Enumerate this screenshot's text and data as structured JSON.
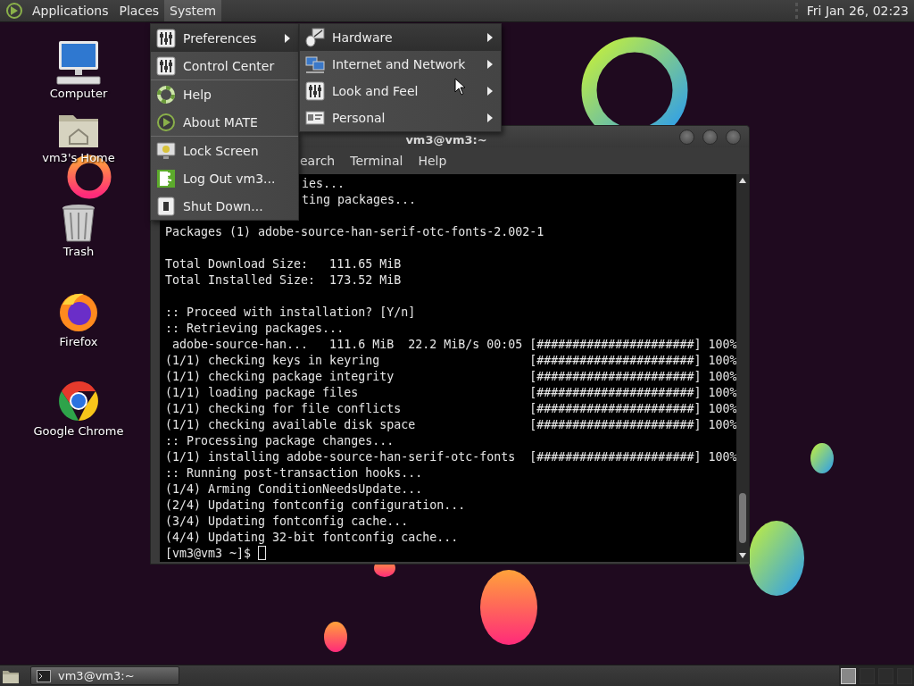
{
  "top_panel": {
    "menus": [
      {
        "label": "Applications",
        "selected": false
      },
      {
        "label": "Places",
        "selected": false
      },
      {
        "label": "System",
        "selected": true
      }
    ],
    "clock": "Fri Jan 26, 02:23"
  },
  "desktop_icons": [
    {
      "label": "Computer"
    },
    {
      "label": "vm3's Home"
    },
    {
      "label": "Trash"
    },
    {
      "label": "Firefox"
    },
    {
      "label": "Google Chrome"
    }
  ],
  "terminal": {
    "title": "vm3@vm3:~",
    "menubar": [
      "earch",
      "Terminal",
      "Help"
    ],
    "lines": [
      {
        "kind": "covered",
        "text": "ies..."
      },
      {
        "kind": "covered",
        "text": "ting packages..."
      },
      {
        "kind": "blank"
      },
      {
        "kind": "text",
        "text": "Packages (1) adobe-source-han-serif-otc-fonts-2.002-1"
      },
      {
        "kind": "blank"
      },
      {
        "kind": "text",
        "text": "Total Download Size:   111.65 MiB"
      },
      {
        "kind": "text",
        "text": "Total Installed Size:  173.52 MiB"
      },
      {
        "kind": "blank"
      },
      {
        "kind": "text",
        "text": ":: Proceed with installation? [Y/n]"
      },
      {
        "kind": "text",
        "text": ":: Retrieving packages..."
      },
      {
        "kind": "text",
        "text": " adobe-source-han...   111.6 MiB  22.2 MiB/s 00:05 [######################] 100%"
      },
      {
        "kind": "text",
        "text": "(1/1) checking keys in keyring                     [######################] 100%"
      },
      {
        "kind": "text",
        "text": "(1/1) checking package integrity                   [######################] 100%"
      },
      {
        "kind": "text",
        "text": "(1/1) loading package files                        [######################] 100%"
      },
      {
        "kind": "text",
        "text": "(1/1) checking for file conflicts                  [######################] 100%"
      },
      {
        "kind": "text",
        "text": "(1/1) checking available disk space                [######################] 100%"
      },
      {
        "kind": "text",
        "text": ":: Processing package changes..."
      },
      {
        "kind": "text",
        "text": "(1/1) installing adobe-source-han-serif-otc-fonts  [######################] 100%"
      },
      {
        "kind": "text",
        "text": ":: Running post-transaction hooks..."
      },
      {
        "kind": "text",
        "text": "(1/4) Arming ConditionNeedsUpdate..."
      },
      {
        "kind": "text",
        "text": "(2/4) Updating fontconfig configuration..."
      },
      {
        "kind": "text",
        "text": "(3/4) Updating fontconfig cache..."
      },
      {
        "kind": "text",
        "text": "(4/4) Updating 32-bit fontconfig cache..."
      }
    ],
    "prompt": "[vm3@vm3 ~]$"
  },
  "system_menu": {
    "items": [
      {
        "kind": "item",
        "label": "Preferences",
        "selected": true,
        "submenu": true
      },
      {
        "kind": "item",
        "label": "Control Center",
        "selected": false,
        "submenu": false
      },
      {
        "kind": "separator"
      },
      {
        "kind": "item",
        "label": "Help",
        "selected": false,
        "submenu": false
      },
      {
        "kind": "item",
        "label": "About MATE",
        "selected": false,
        "submenu": false
      },
      {
        "kind": "separator"
      },
      {
        "kind": "item",
        "label": "Lock Screen",
        "selected": false,
        "submenu": false
      },
      {
        "kind": "item",
        "label": "Log Out vm3...",
        "selected": false,
        "submenu": false
      },
      {
        "kind": "item",
        "label": "Shut Down...",
        "selected": false,
        "submenu": false
      }
    ]
  },
  "preferences_submenu": {
    "items": [
      {
        "kind": "item",
        "label": "Hardware",
        "selected": true,
        "submenu": true
      },
      {
        "kind": "item",
        "label": "Internet and Network",
        "selected": false,
        "submenu": true
      },
      {
        "kind": "item",
        "label": "Look and Feel",
        "selected": false,
        "submenu": true
      },
      {
        "kind": "item",
        "label": "Personal",
        "selected": false,
        "submenu": true
      }
    ]
  },
  "taskbar": {
    "tasks": [
      {
        "label": "vm3@vm3:~",
        "selected": true
      }
    ]
  }
}
